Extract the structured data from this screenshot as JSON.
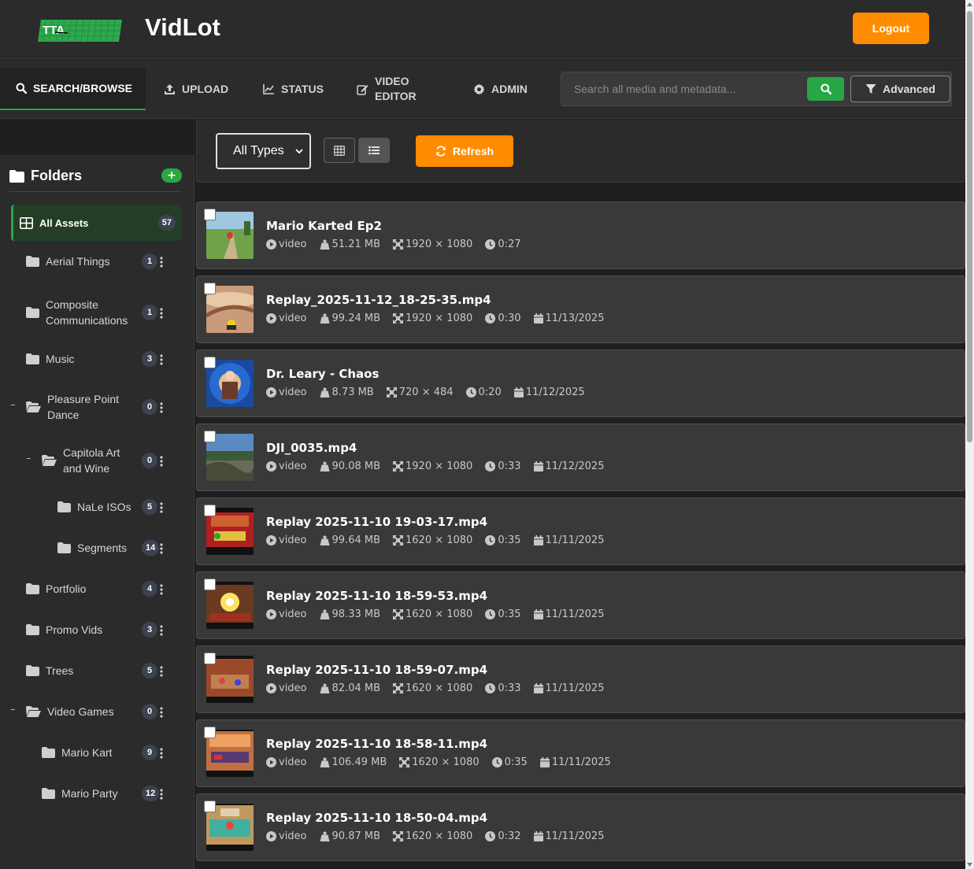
{
  "header": {
    "brand": "VidLot",
    "logo_text": "TTA",
    "logout_label": "Logout"
  },
  "nav": {
    "tabs": [
      {
        "label": "SEARCH/BROWSE",
        "icon": "search-icon",
        "active": true
      },
      {
        "label": "UPLOAD",
        "icon": "upload-icon"
      },
      {
        "label": "STATUS",
        "icon": "chart-line-icon"
      },
      {
        "label_line1": "VIDEO",
        "label_line2": "EDITOR",
        "icon": "edit-icon"
      },
      {
        "label": "ADMIN",
        "icon": "gear-icon"
      }
    ],
    "search_placeholder": "Search all media and metadata...",
    "advanced_label": "Advanced"
  },
  "sidebar": {
    "title": "Folders",
    "add_label": "+",
    "all_assets": {
      "label": "All Assets",
      "count": "57"
    },
    "folders": [
      {
        "name": "Aerial Things",
        "count": "1"
      },
      {
        "name_line1": "Composite",
        "name_line2": "Communications",
        "count": "1"
      },
      {
        "name": "Music",
        "count": "3"
      },
      {
        "name_line1": "Pleasure Point",
        "name_line2": "Dance",
        "count": "0",
        "expanded": true
      },
      {
        "name_line1": "Capitola Art",
        "name_line2": "and Wine",
        "count": "0",
        "expanded": true
      },
      {
        "name": "NaLe ISOs",
        "count": "5"
      },
      {
        "name": "Segments",
        "count": "14"
      },
      {
        "name": "Portfolio",
        "count": "4"
      },
      {
        "name": "Promo Vids",
        "count": "3"
      },
      {
        "name": "Trees",
        "count": "5"
      },
      {
        "name": "Video Games",
        "count": "0",
        "expanded": true
      },
      {
        "name": "Mario Kart",
        "count": "9"
      },
      {
        "name": "Mario Party",
        "count": "12"
      }
    ]
  },
  "toolbar": {
    "type_filter": "All Types",
    "refresh_label": "Refresh"
  },
  "assets": [
    {
      "title": "Mario Karted Ep2",
      "type": "video",
      "size": "51.21 MB",
      "dims": "1920 × 1080",
      "duration": "0:27",
      "date": ""
    },
    {
      "title": "Replay_2025-11-12_18-25-35.mp4",
      "type": "video",
      "size": "99.24 MB",
      "dims": "1920 × 1080",
      "duration": "0:30",
      "date": "11/13/2025"
    },
    {
      "title": "Dr. Leary - Chaos",
      "type": "video",
      "size": "8.73 MB",
      "dims": "720 × 484",
      "duration": "0:20",
      "date": "11/12/2025"
    },
    {
      "title": "DJI_0035.mp4",
      "type": "video",
      "size": "90.08 MB",
      "dims": "1920 × 1080",
      "duration": "0:33",
      "date": "11/12/2025"
    },
    {
      "title": "Replay 2025-11-10 19-03-17.mp4",
      "type": "video",
      "size": "99.64 MB",
      "dims": "1620 × 1080",
      "duration": "0:35",
      "date": "11/11/2025"
    },
    {
      "title": "Replay 2025-11-10 18-59-53.mp4",
      "type": "video",
      "size": "98.33 MB",
      "dims": "1620 × 1080",
      "duration": "0:35",
      "date": "11/11/2025"
    },
    {
      "title": "Replay 2025-11-10 18-59-07.mp4",
      "type": "video",
      "size": "82.04 MB",
      "dims": "1620 × 1080",
      "duration": "0:33",
      "date": "11/11/2025"
    },
    {
      "title": "Replay 2025-11-10 18-58-11.mp4",
      "type": "video",
      "size": "106.49 MB",
      "dims": "1620 × 1080",
      "duration": "0:35",
      "date": "11/11/2025"
    },
    {
      "title": "Replay 2025-11-10 18-50-04.mp4",
      "type": "video",
      "size": "90.87 MB",
      "dims": "1620 × 1080",
      "duration": "0:32",
      "date": "11/11/2025"
    }
  ],
  "colors": {
    "accent_orange": "#ff8c00",
    "accent_green": "#28a745",
    "background": "#1f1f1f",
    "panel": "#2b2b2b",
    "card": "#393939"
  }
}
